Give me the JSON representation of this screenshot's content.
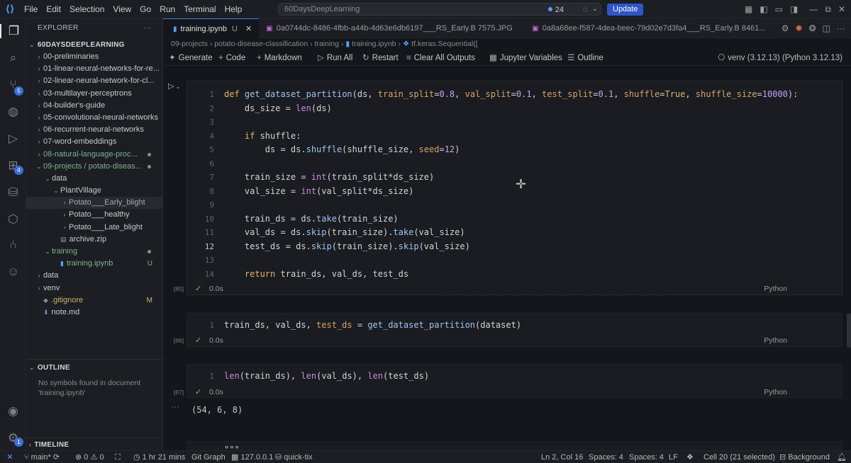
{
  "titlebar": {
    "menus": [
      "File",
      "Edit",
      "Selection",
      "View",
      "Go",
      "Run",
      "Terminal",
      "Help"
    ],
    "search_text": "60DaysDeepLearning",
    "notifications_count": "24",
    "update_label": "Update"
  },
  "activity_badges": {
    "source_control": "5",
    "extensions": "4",
    "manage": "1"
  },
  "sidebar": {
    "explorer_title": "EXPLORER",
    "project_title": "60DAYSDEEPLEARNING",
    "tree": [
      {
        "label": "00-preliminaries",
        "chev": "›",
        "indent": 0
      },
      {
        "label": "01-linear-neural-networks-for-re...",
        "chev": "›",
        "indent": 0
      },
      {
        "label": "02-linear-neural-network-for-cl...",
        "chev": "›",
        "indent": 0
      },
      {
        "label": "03-multilayer-perceptrons",
        "chev": "›",
        "indent": 0
      },
      {
        "label": "04-builder's-guide",
        "chev": "›",
        "indent": 0
      },
      {
        "label": "05-convolutional-neural-networks",
        "chev": "›",
        "indent": 0
      },
      {
        "label": "06-recurrent-neural-networks",
        "chev": "›",
        "indent": 0
      },
      {
        "label": "07-word-embeddings",
        "chev": "›",
        "indent": 0
      },
      {
        "label": "08-natural-language-proc...",
        "chev": "›",
        "indent": 0,
        "color": "green",
        "dot": true
      },
      {
        "label": "09-projects / potato-diseas...",
        "chev": "⌄",
        "indent": 0,
        "color": "green",
        "dot": true
      },
      {
        "label": "data",
        "chev": "⌄",
        "indent": 1
      },
      {
        "label": "PlantVillage",
        "chev": "⌄",
        "indent": 2
      },
      {
        "label": "Potato___Early_blight",
        "chev": "›",
        "indent": 3,
        "selected": true
      },
      {
        "label": "Potato___healthy",
        "chev": "›",
        "indent": 3
      },
      {
        "label": "Potato___Late_blight",
        "chev": "›",
        "indent": 3
      },
      {
        "label": "archive.zip",
        "chev": "",
        "indent": 2,
        "icon": "▤"
      },
      {
        "label": "training",
        "chev": "⌄",
        "indent": 1,
        "color": "green",
        "dot": true
      },
      {
        "label": "training.ipynb",
        "chev": "",
        "indent": 2,
        "icon": "▮",
        "color": "green",
        "badge": "U"
      },
      {
        "label": "data",
        "chev": "›",
        "indent": 0
      },
      {
        "label": "venv",
        "chev": "›",
        "indent": 0
      },
      {
        "label": ".gitignore",
        "chev": "",
        "indent": 0,
        "icon": "◆",
        "color": "yellow",
        "badge": "M"
      },
      {
        "label": "note.md",
        "chev": "",
        "indent": 0,
        "icon": "⬇"
      }
    ],
    "outline_title": "OUTLINE",
    "outline_empty": "No symbols found in document 'training.ipynb'",
    "timeline_title": "TIMELINE"
  },
  "tabs": [
    {
      "label": "training.ipynb",
      "status": "U",
      "active": true
    },
    {
      "label": "0a0744dc-8486-4fbb-a44b-4d63e6db6197___RS_Early.B 7575.JPG",
      "active": false
    },
    {
      "label": "0a8a68ee-f587-4dea-beec-79d02e7d3fa4___RS_Early.B 8461...",
      "active": false
    }
  ],
  "breadcrumb": [
    "09-projects",
    "potato-disease-classification",
    "training",
    "training.ipynb",
    "tf.keras.Sequential(["
  ],
  "toolbar": {
    "generate": "Generate",
    "code": "Code",
    "markdown": "Markdown",
    "run_all": "Run All",
    "restart": "Restart",
    "clear_outputs": "Clear All Outputs",
    "variables": "Jupyter Variables",
    "outline": "Outline",
    "kernel": "venv (3.12.13) (Python 3.12.13)"
  },
  "cells": [
    {
      "exec_count": "[85]",
      "time": "0.0s",
      "language": "Python",
      "current_line": 12,
      "lines": [
        "def get_dataset_partition(ds, train_split=0.8, val_split=0.1, test_split=0.1, shuffle=True, shuffle_size=10000):",
        "    ds_size = len(ds)",
        "",
        "    if shuffle:",
        "        ds = ds.shuffle(shuffle_size, seed=12)",
        "",
        "    train_size = int(train_split*ds_size)",
        "    val_size = int(val_split*ds_size)",
        "",
        "    train_ds = ds.take(train_size)",
        "    val_ds = ds.skip(train_size).take(val_size)",
        "    test_ds = ds.skip(train_size).skip(val_size)",
        "",
        "    return train_ds, val_ds, test_ds"
      ]
    },
    {
      "exec_count": "[86]",
      "time": "0.0s",
      "language": "Python",
      "lines": [
        "train_ds, val_ds, test_ds = get_dataset_partition(dataset)"
      ]
    },
    {
      "exec_count": "[87]",
      "time": "0.0s",
      "language": "Python",
      "lines": [
        "len(train_ds), len(val_ds), len(test_ds)"
      ],
      "output": "(54, 6, 8)"
    }
  ],
  "next_cell_text": "\"\"\"",
  "statusbar": {
    "branch": "main*",
    "errors": "0",
    "warnings": "0",
    "time": "1 hr 21 mins",
    "git_graph": "Git Graph",
    "host": "127.0.0.1",
    "db": "quick-tix",
    "cursor": "Ln 2, Col 16",
    "spaces1": "Spaces: 4",
    "spaces2": "Spaces: 4",
    "eol": "LF",
    "cell": "Cell 20 (21 selected)",
    "background": "Background"
  }
}
